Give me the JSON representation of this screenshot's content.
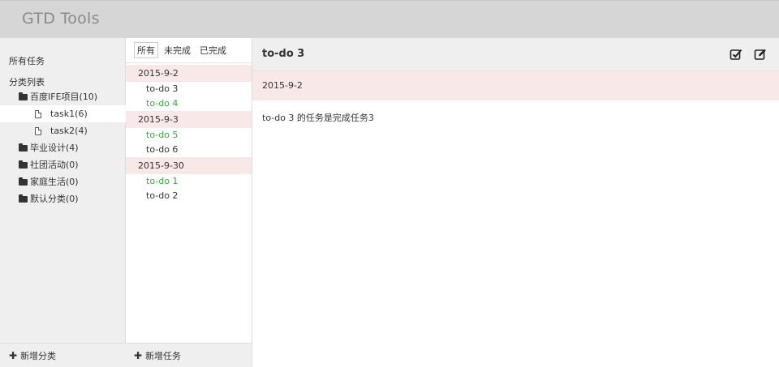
{
  "app": {
    "title": "GTD Tools"
  },
  "sidebar": {
    "all_tasks": "所有任务",
    "category_label": "分类列表",
    "categories": [
      {
        "label": "百度IFE项目(10)",
        "children": [
          {
            "label": "task1(6)",
            "active": true
          },
          {
            "label": "task2(4)",
            "active": false
          }
        ]
      },
      {
        "label": "毕业设计(4)"
      },
      {
        "label": "社团活动(0)"
      },
      {
        "label": "家庭生活(0)"
      },
      {
        "label": "默认分类(0)"
      }
    ],
    "add_category_label": "新增分类"
  },
  "task_panel": {
    "filters": [
      {
        "label": "所有",
        "active": true
      },
      {
        "label": "未完成",
        "active": false
      },
      {
        "label": "已完成",
        "active": false
      }
    ],
    "groups": [
      {
        "date": "2015-9-2",
        "tasks": [
          {
            "label": "to-do 3",
            "done": false
          },
          {
            "label": "to-do 4",
            "done": true
          }
        ]
      },
      {
        "date": "2015-9-3",
        "tasks": [
          {
            "label": "to-do 5",
            "done": true
          },
          {
            "label": "to-do 6",
            "done": false
          }
        ]
      },
      {
        "date": "2015-9-30",
        "tasks": [
          {
            "label": "to-do 1",
            "done": true
          },
          {
            "label": "to-do 2",
            "done": false
          }
        ]
      }
    ],
    "add_task_label": "新增任务"
  },
  "detail": {
    "title": "to-do 3",
    "date": "2015-9-2",
    "content": "to-do 3 的任务是完成任务3",
    "icons": {
      "complete": "check-square-icon",
      "edit": "edit-icon"
    }
  },
  "colors": {
    "header_bg": "#d6d6d6",
    "sidebar_bg": "#efefef",
    "date_row_bg": "#f9e8e8",
    "done_text": "#3aaa3a"
  }
}
